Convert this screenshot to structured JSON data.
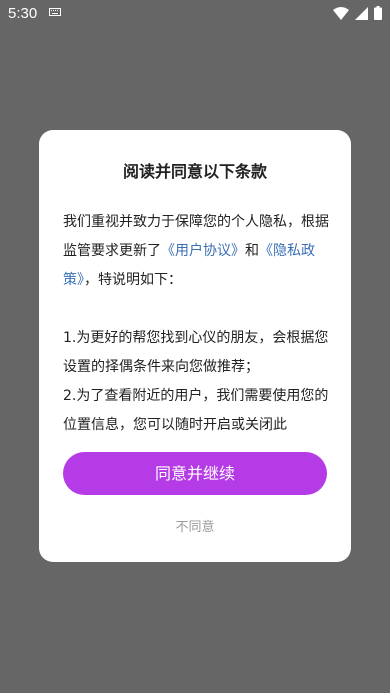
{
  "status_bar": {
    "time": "5:30",
    "icons": [
      "keyboard-icon",
      "wifi-icon",
      "signal-icon",
      "battery-icon"
    ]
  },
  "dialog": {
    "title": "阅读并同意以下条款",
    "intro": {
      "text1": "我们重视并致力于保障您的个人隐私，根据监管要求更新了",
      "link_user_agreement": "《用户协议》",
      "text2": "和",
      "link_privacy_policy": "《隐私政策》",
      "text3": "，特说明如下："
    },
    "item1": "1.为更好的帮您找到心仪的朋友，会根据您设置的择偶条件来向您做推荐；",
    "item2": "2.为了查看附近的用户，我们需要使用您的位置信息，您可以随时开启或关闭此",
    "agree_button_label": "同意并继续",
    "disagree_label": "不同意"
  },
  "colors": {
    "overlay": "#666666",
    "accent": "#b53be6",
    "link": "#3b6fb5"
  }
}
